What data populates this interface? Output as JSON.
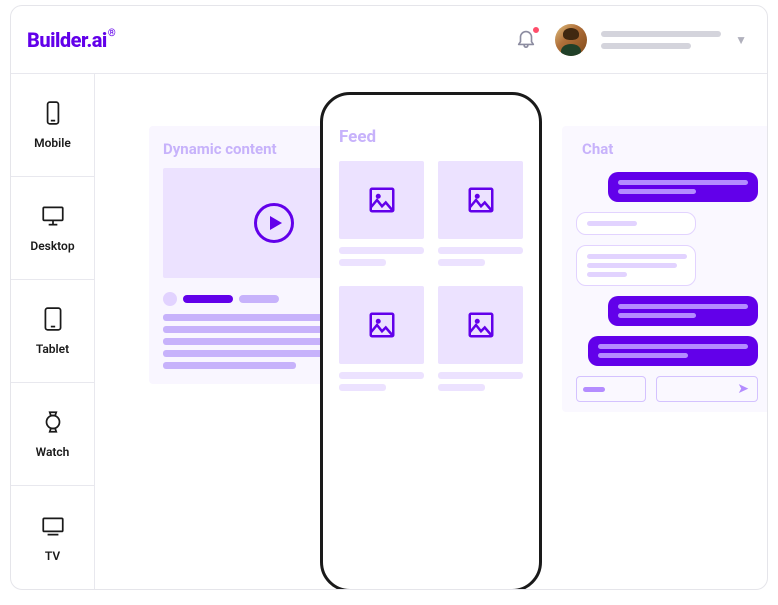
{
  "brand": {
    "name": "Builder.ai",
    "mark": "®"
  },
  "header": {
    "notification_icon": "bell-icon",
    "has_notification": true,
    "dropdown_caret": "▼"
  },
  "sidebar": {
    "items": [
      {
        "id": "mobile",
        "label": "Mobile"
      },
      {
        "id": "desktop",
        "label": "Desktop"
      },
      {
        "id": "tablet",
        "label": "Tablet"
      },
      {
        "id": "watch",
        "label": "Watch"
      },
      {
        "id": "tv",
        "label": "TV"
      }
    ]
  },
  "canvas": {
    "left_card": {
      "title": "Dynamic content"
    },
    "phone": {
      "title": "Feed"
    },
    "right_card": {
      "title": "Chat",
      "send_glyph": "➤"
    }
  },
  "colors": {
    "brand": "#6200EA",
    "light": "#ece2ff",
    "faded_text": "#c7b2fb",
    "notification": "#ff4d6a"
  }
}
